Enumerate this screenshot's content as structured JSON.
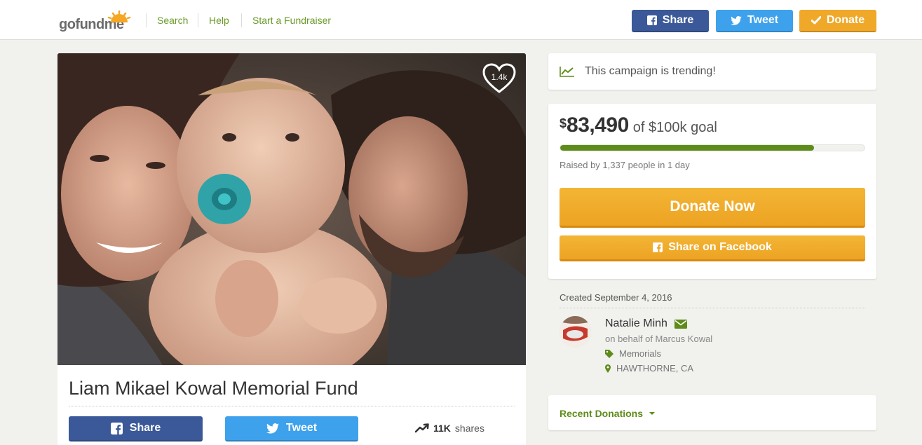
{
  "header": {
    "logo_text": "gofundme",
    "nav": [
      {
        "label": "Search"
      },
      {
        "label": "Help"
      },
      {
        "label": "Start a Fundraiser"
      }
    ],
    "share_label": "Share",
    "tweet_label": "Tweet",
    "donate_label": "Donate"
  },
  "campaign": {
    "title": "Liam Mikael Kowal Memorial Fund",
    "heart_count": "1.4k",
    "share_label": "Share",
    "tweet_label": "Tweet",
    "shares_count": "11K",
    "shares_suffix": "shares"
  },
  "sidebar": {
    "trending_text": "This campaign is trending!",
    "currency": "$",
    "raised_amount": "83,490",
    "goal_text": "of $100k goal",
    "progress_fraction": 0.8349,
    "raised_by": "Raised by 1,337 people in 1 day",
    "donate_now_label": "Donate Now",
    "share_facebook_label": "Share on Facebook",
    "created": "Created September 4, 2016",
    "organizer_name": "Natalie Minh",
    "on_behalf": "on behalf of Marcus Kowal",
    "category": "Memorials",
    "location": "HAWTHORNE, CA",
    "recent_donations_label": "Recent Donations"
  },
  "colors": {
    "brand_green": "#5e8c1a",
    "facebook_blue": "#3b5998",
    "twitter_blue": "#3ea1ec",
    "donate_orange": "#f0a829"
  },
  "icons": [
    "facebook-icon",
    "twitter-icon",
    "checkmark-icon",
    "heart-icon",
    "trending-icon",
    "envelope-icon",
    "tag-icon",
    "map-pin-icon",
    "chevron-down-icon"
  ]
}
